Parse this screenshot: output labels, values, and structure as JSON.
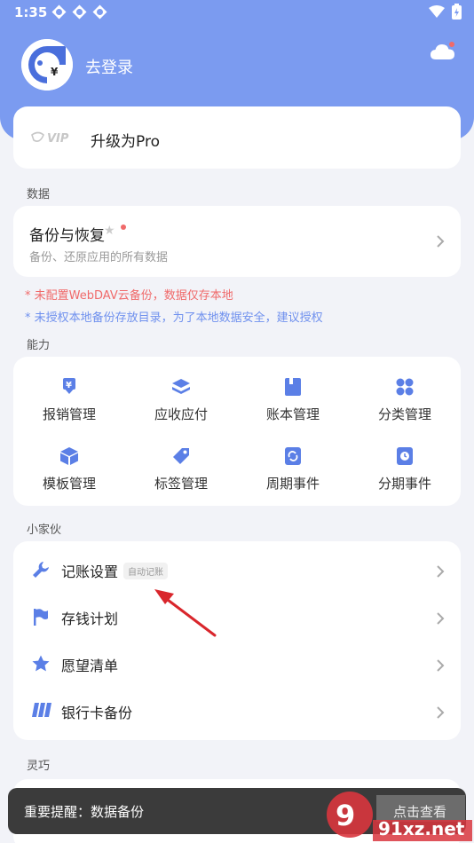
{
  "status_bar": {
    "time": "1:35"
  },
  "header": {
    "login_label": "去登录"
  },
  "pro": {
    "logo_text": "VIP",
    "label": "升级为Pro"
  },
  "sections": {
    "data": "数据",
    "abilities": "能力",
    "buddy": "小家伙",
    "smart": "灵巧"
  },
  "backup": {
    "title": "备份与恢复",
    "subtitle": "备份、还原应用的所有数据"
  },
  "warnings": {
    "webdav": "* 未配置WebDAV云备份，数据仅存本地",
    "local": "* 未授权本地备份存放目录，为了本地数据安全，建议授权"
  },
  "abilities": [
    {
      "label": "报销管理",
      "icon": "reimburse-icon"
    },
    {
      "label": "应收应付",
      "icon": "layers-icon"
    },
    {
      "label": "账本管理",
      "icon": "book-icon"
    },
    {
      "label": "分类管理",
      "icon": "category-icon"
    },
    {
      "label": "模板管理",
      "icon": "template-icon"
    },
    {
      "label": "标签管理",
      "icon": "tag-icon"
    },
    {
      "label": "周期事件",
      "icon": "cycle-icon"
    },
    {
      "label": "分期事件",
      "icon": "installment-icon"
    }
  ],
  "buddy_items": [
    {
      "label": "记账设置",
      "badge": "自动记账",
      "icon": "wrench-icon"
    },
    {
      "label": "存钱计划",
      "icon": "flag-icon"
    },
    {
      "label": "愿望清单",
      "icon": "star-icon"
    },
    {
      "label": "银行卡备份",
      "icon": "card-icon"
    }
  ],
  "toast": {
    "message": "重要提醒：数据备份",
    "action": "点击查看"
  },
  "watermark": {
    "text": "91xz.net"
  },
  "colors": {
    "accent": "#7b9bf0",
    "warning_red": "#f06a6a",
    "warning_blue": "#6f90ee",
    "icon_blue": "#5b7fe6"
  }
}
